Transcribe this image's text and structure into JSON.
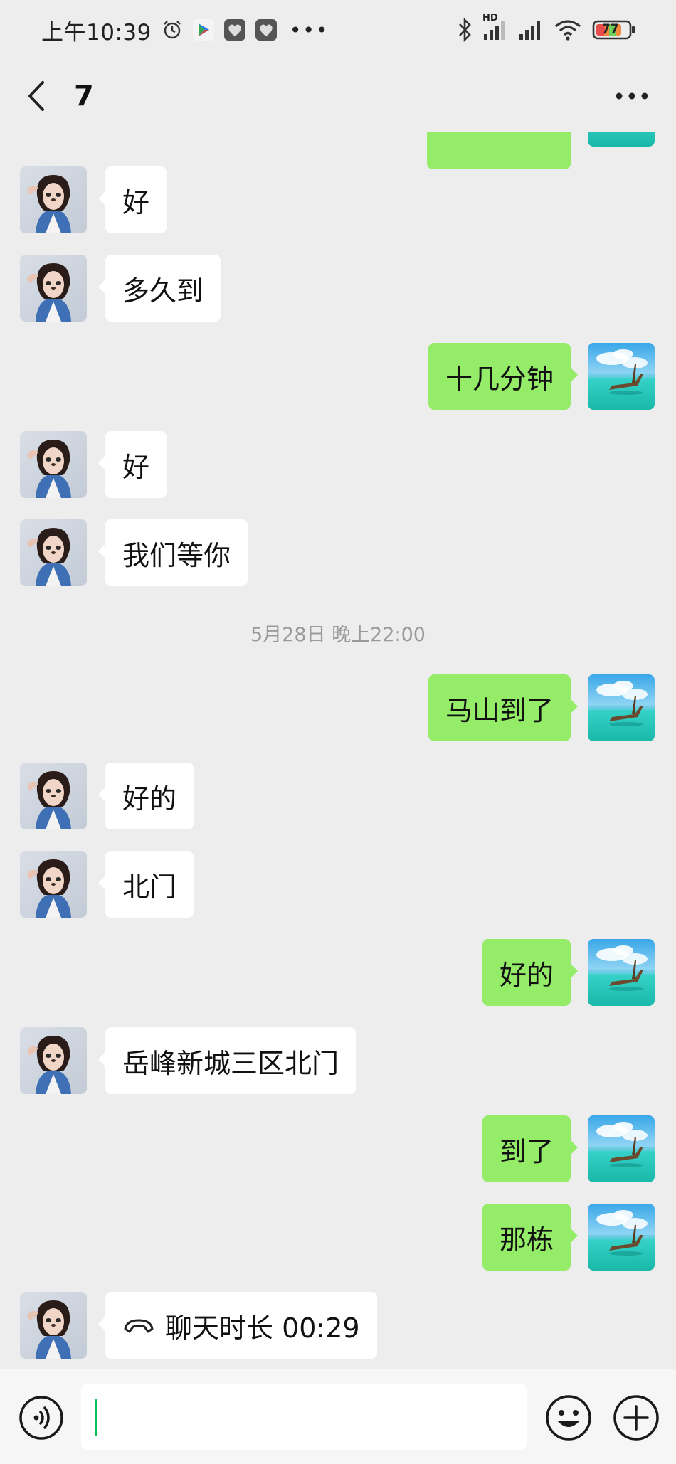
{
  "status_bar": {
    "time": "上午10:39",
    "network_label": "HD",
    "battery": "77"
  },
  "header": {
    "title": "7"
  },
  "messages": [
    {
      "side": "left",
      "text": "好"
    },
    {
      "side": "left",
      "text": "多久到"
    },
    {
      "side": "right",
      "text": "十几分钟"
    },
    {
      "side": "left",
      "text": "好"
    },
    {
      "side": "left",
      "text": "我们等你"
    },
    {
      "side": "right",
      "text": "马山到了"
    },
    {
      "side": "left",
      "text": "好的"
    },
    {
      "side": "left",
      "text": "北门"
    },
    {
      "side": "right",
      "text": "好的"
    },
    {
      "side": "left",
      "text": "岳峰新城三区北门"
    },
    {
      "side": "right",
      "text": "到了"
    },
    {
      "side": "right",
      "text": "那栋"
    },
    {
      "side": "left",
      "text": "聊天时长 00:29",
      "icon": "phone-hangup-icon"
    }
  ],
  "timestamp": "5月28日 晚上22:00",
  "input_bar": {
    "value": "",
    "icons": [
      "voice-icon",
      "emoji-icon",
      "plus-icon"
    ]
  },
  "colors": {
    "background": "#ededed",
    "sent_bubble": "#95ec69",
    "received_bubble": "#ffffff",
    "cursor": "#07c160"
  }
}
